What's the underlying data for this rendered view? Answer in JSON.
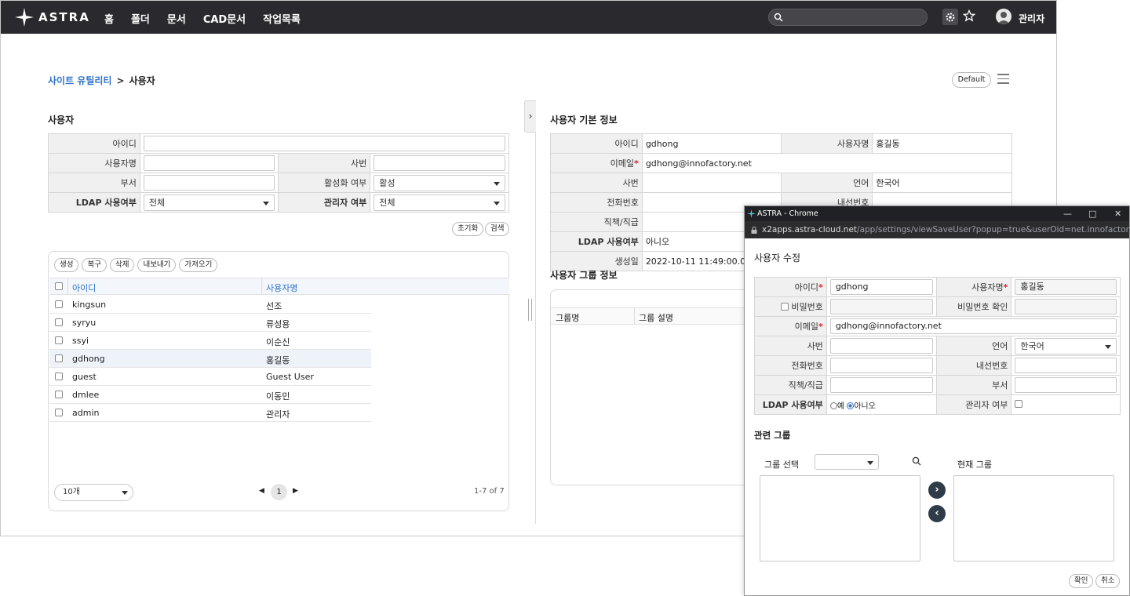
{
  "app": {
    "logo_text": "ASTRA",
    "nav": [
      "홈",
      "폴더",
      "문서",
      "CAD문서",
      "작업목록"
    ],
    "user_name": "관리자"
  },
  "breadcrumb": {
    "parent": "사이트 유틸리티",
    "separator": ">",
    "current": "사용자"
  },
  "view_button": "Default",
  "search_panel": {
    "title": "사용자",
    "id_label": "아이디",
    "name_label": "사용자명",
    "empno_label": "사번",
    "dept_label": "부서",
    "active_label": "활성화 여부",
    "active_value": "활성",
    "ldap_label": "LDAP 사용여부",
    "ldap_value": "전체",
    "admin_label": "관리자 여부",
    "admin_value": "전체",
    "reset_button": "초기화",
    "search_button": "검색"
  },
  "grid": {
    "actions": [
      "생성",
      "복구",
      "삭제",
      "내보내기",
      "가져오기"
    ],
    "columns": [
      "아이디",
      "사용자명"
    ],
    "rows": [
      {
        "id": "kingsun",
        "name": "선조"
      },
      {
        "id": "syryu",
        "name": "류성용"
      },
      {
        "id": "ssyi",
        "name": "이순신"
      },
      {
        "id": "gdhong",
        "name": "홍길동"
      },
      {
        "id": "guest",
        "name": "Guest User"
      },
      {
        "id": "dmlee",
        "name": "이동민"
      },
      {
        "id": "admin",
        "name": "관리자"
      }
    ],
    "page_size": "10개",
    "current_page": "1",
    "count_text": "1-7 of 7"
  },
  "detail": {
    "title": "사용자 기본 정보",
    "id_label": "아이디",
    "id_value": "gdhong",
    "name_label": "사용자명",
    "name_value": "홍길동",
    "email_label": "이메일",
    "email_value": "gdhong@innofactory.net",
    "empno_label": "사번",
    "lang_label": "언어",
    "lang_value": "한국어",
    "phone_label": "전화번호",
    "ext_label": "내선번호",
    "position_label": "직책/직급",
    "ldap_label": "LDAP 사용여부",
    "ldap_value": "아니오",
    "created_label": "생성일",
    "created_value": "2022-10-11 11:49:00.0",
    "group_title": "사용자 그룹 정보",
    "group_columns": [
      "그룹명",
      "그룹 설명"
    ]
  },
  "popup": {
    "window_title": "ASTRA - Chrome",
    "url_host": "x2apps.astra-cloud.net",
    "url_path": "/app/settings/viewSaveUser?popup=true&userOid=net.innofactory.astra.org.U...",
    "title": "사용자 수정",
    "id_label": "아이디",
    "id_value": "gdhong",
    "name_label": "사용자명",
    "name_value": "홍길동",
    "password_label": "비밀번호",
    "password_confirm_label": "비밀번호 확인",
    "email_label": "이메일",
    "email_value": "gdhong@innofactory.net",
    "empno_label": "사번",
    "lang_label": "언어",
    "lang_value": "한국어",
    "phone_label": "전화번호",
    "ext_label": "내선번호",
    "position_label": "직책/직급",
    "dept_label": "부서",
    "ldap_label": "LDAP 사용여부",
    "ldap_yes": "예",
    "ldap_no": "아니오",
    "admin_label": "관리자 여부",
    "related_title": "관련 그룹",
    "group_select_label": "그룹 선택",
    "current_group_label": "현재 그룹",
    "ok_button": "확인",
    "cancel_button": "취소"
  },
  "colors": {
    "topbar": "#2a2a2e",
    "link": "#2f73c9",
    "required": "#d8232a"
  }
}
